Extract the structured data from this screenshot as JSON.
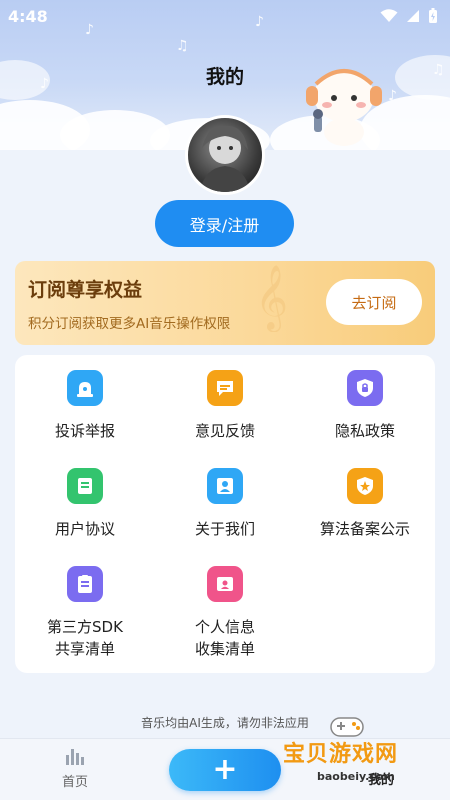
{
  "status": {
    "time": "4:48"
  },
  "header": {
    "title": "我的"
  },
  "account": {
    "login_label": "登录/注册"
  },
  "subscription": {
    "title": "订阅尊享权益",
    "description": "积分订阅获取更多AI音乐操作权限",
    "button_label": "去订阅"
  },
  "menu": {
    "items": [
      {
        "label": "投诉举报",
        "icon": "alarm-icon",
        "color": "#2fa7f5"
      },
      {
        "label": "意见反馈",
        "icon": "chat-icon",
        "color": "#f5a216"
      },
      {
        "label": "隐私政策",
        "icon": "shield-lock-icon",
        "color": "#7b6cf0"
      },
      {
        "label": "用户协议",
        "icon": "document-icon",
        "color": "#33c46e"
      },
      {
        "label": "关于我们",
        "icon": "person-icon",
        "color": "#2fa7f5"
      },
      {
        "label": "算法备案公示",
        "icon": "badge-star-icon",
        "color": "#f5a216"
      },
      {
        "label_line1": "第三方SDK",
        "label_line2": "共享清单",
        "icon": "clipboard-list-icon",
        "color": "#7b6cf0"
      },
      {
        "label_line1": "个人信息",
        "label_line2": "收集清单",
        "icon": "id-card-icon",
        "color": "#f0548a"
      }
    ]
  },
  "footer": {
    "notice": "音乐均由AI生成，请勿非法应用"
  },
  "nav": {
    "home_label": "首页",
    "add_symbol": "+",
    "mine_label": "我的"
  },
  "watermark": {
    "text": "宝贝游戏网",
    "url": "baobeiy.com"
  }
}
